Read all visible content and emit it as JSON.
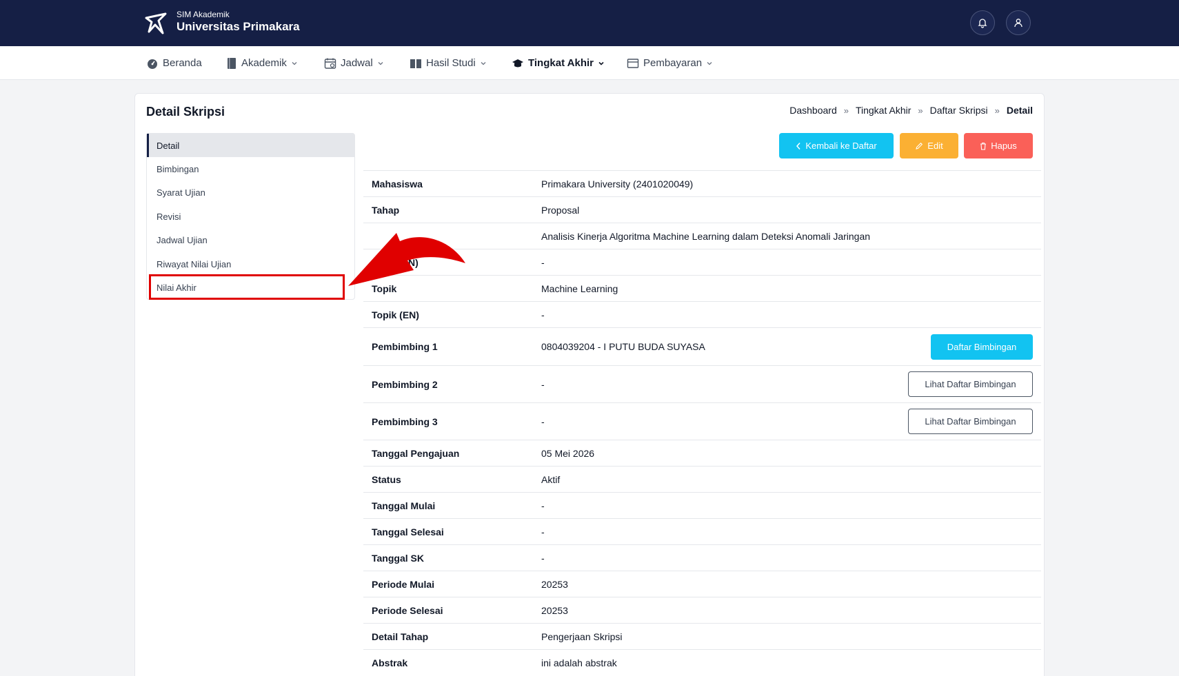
{
  "brand": {
    "small": "SIM Akademik",
    "big": "Universitas Primakara"
  },
  "topbar_icons": [
    "bell-icon",
    "user-icon"
  ],
  "nav": {
    "items": [
      {
        "label": "Beranda",
        "icon": "dashboard-icon"
      },
      {
        "label": "Akademik",
        "icon": "book-icon"
      },
      {
        "label": "Jadwal",
        "icon": "calendar-icon"
      },
      {
        "label": "Hasil Studi",
        "icon": "book-open-icon"
      },
      {
        "label": "Tingkat Akhir",
        "icon": "graduation-cap-icon",
        "active": true
      },
      {
        "label": "Pembayaran",
        "icon": "wallet-icon"
      }
    ]
  },
  "page": {
    "title": "Detail Skripsi"
  },
  "breadcrumb": [
    "Dashboard",
    "Tingkat Akhir",
    "Daftar Skripsi",
    "Detail"
  ],
  "sidemenu": {
    "items": [
      {
        "label": "Detail",
        "active": true
      },
      {
        "label": "Bimbingan"
      },
      {
        "label": "Syarat Ujian"
      },
      {
        "label": "Revisi"
      },
      {
        "label": "Jadwal Ujian"
      },
      {
        "label": "Riwayat Nilai Ujian"
      },
      {
        "label": "Nilai Akhir",
        "highlighted": true
      }
    ]
  },
  "actions": {
    "back": "Kembali ke Daftar",
    "edit": "Edit",
    "delete": "Hapus"
  },
  "details": [
    {
      "label": "Mahasiswa",
      "value": "Primakara University (2401020049)"
    },
    {
      "label": "Tahap",
      "value": "Proposal"
    },
    {
      "label": "",
      "value": "Analisis Kinerja Algoritma Machine Learning dalam Deteksi Anomali Jaringan"
    },
    {
      "label": "N)",
      "value": "-"
    },
    {
      "label": "Topik",
      "value": "Machine Learning"
    },
    {
      "label": "Topik (EN)",
      "value": "-"
    },
    {
      "label": "Pembimbing 1",
      "value": "0804039204 - I PUTU BUDA SUYASA",
      "button": "Daftar Bimbingan"
    },
    {
      "label": "Pembimbing 2",
      "value": "-",
      "button": "Lihat Daftar Bimbingan"
    },
    {
      "label": "Pembimbing 3",
      "value": "-",
      "button": "Lihat Daftar Bimbingan"
    },
    {
      "label": "Tanggal Pengajuan",
      "value": "05 Mei 2026"
    },
    {
      "label": "Status",
      "value": "Aktif"
    },
    {
      "label": "Tanggal Mulai",
      "value": "-"
    },
    {
      "label": "Tanggal Selesai",
      "value": "-"
    },
    {
      "label": "Tanggal SK",
      "value": "-"
    },
    {
      "label": "Periode Mulai",
      "value": "20253"
    },
    {
      "label": "Periode Selesai",
      "value": "20253"
    },
    {
      "label": "Detail Tahap",
      "value": "Pengerjaan Skripsi"
    },
    {
      "label": "Abstrak",
      "value": "ini adalah abstrak"
    }
  ],
  "colors": {
    "topbar": "#151f45",
    "info": "#12c3f1",
    "warning": "#fbb033",
    "danger": "#fa6058",
    "annotation": "#e00000"
  }
}
